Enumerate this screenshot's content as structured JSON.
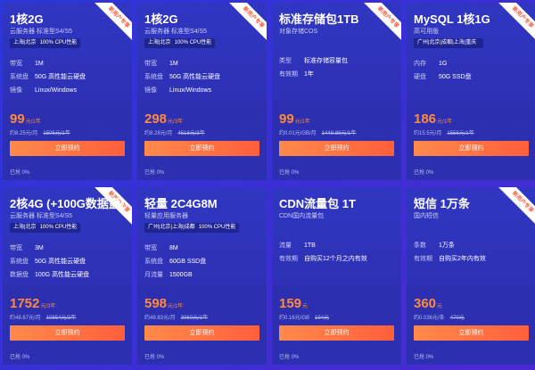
{
  "cards": [
    {
      "badge": "新用户专享",
      "title": "1核2G",
      "subtitle": "云服务器 标准型S4/S5",
      "tag_a": "上海|北京",
      "tag_b": "100% CPU性能",
      "specs": [
        [
          "带宽",
          "1M"
        ],
        [
          "系统盘",
          "50G 高性能云硬盘"
        ],
        [
          "镜像",
          "Linux/Windows"
        ]
      ],
      "price": "99",
      "unit": "元/1年",
      "sub": "约8.25元/月",
      "orig": "1506元/1年",
      "button": "立即预约",
      "sold": "已抢 0%"
    },
    {
      "badge": "新用户专享",
      "title": "1核2G",
      "subtitle": "云服务器 标准型S4/S5",
      "tag_a": "上海|北京",
      "tag_b": "100% CPU性能",
      "specs": [
        [
          "带宽",
          "1M"
        ],
        [
          "系统盘",
          "50G 高性能云硬盘"
        ],
        [
          "镜像",
          "Linux/Windows"
        ]
      ],
      "price": "298",
      "unit": "元/3年",
      "sub": "约8.28元/月",
      "orig": "4518元/3年",
      "button": "立即预约",
      "sold": "已抢 0%"
    },
    {
      "badge": "新用户专享",
      "title": "标准存储包1TB",
      "subtitle": "对象存储COS",
      "tag_a": "",
      "tag_b": "",
      "specs": [
        [
          "类型",
          "标准存储容量包"
        ],
        [
          "有效期",
          "1年"
        ]
      ],
      "price": "99",
      "unit": "元/1年",
      "sub": "约0.01元/GB/月",
      "orig": "1449.88元/1年",
      "button": "立即预约",
      "sold": "已抢 0%"
    },
    {
      "badge": "新用户专享",
      "title": "MySQL 1核1G",
      "subtitle": "高可用版",
      "tag_a": "广州|北京|成都|上海|重庆",
      "tag_b": "",
      "specs": [
        [
          "内存",
          "1G"
        ],
        [
          "硬盘",
          "50G SSD盘"
        ]
      ],
      "price": "186",
      "unit": "元/1年",
      "sub": "约15.5元/月",
      "orig": "1556元/1年",
      "button": "立即预约",
      "sold": "已抢 0%"
    },
    {
      "badge": "新用户专享",
      "title": "2核4G (+100G数据盘)",
      "subtitle": "云服务器 标准型S4/S5",
      "tag_a": "上海|北京",
      "tag_b": "100% CPU性能",
      "specs": [
        [
          "带宽",
          "3M"
        ],
        [
          "系统盘",
          "50G 高性能云硬盘"
        ],
        [
          "数据盘",
          "100G 高性能云硬盘"
        ]
      ],
      "price": "1752",
      "unit": "元/3年",
      "sub": "约48.67元/月",
      "orig": "10854元/3年",
      "button": "立即预约",
      "sold": "已抢 0%"
    },
    {
      "badge": "",
      "title": "轻量 2C4G8M",
      "subtitle": "轻量应用服务器",
      "tag_a": "广州|北京|上海|成都",
      "tag_b": "100% CPU性能",
      "specs": [
        [
          "带宽",
          "8M"
        ],
        [
          "系统盘",
          "60GB SSD盘"
        ],
        [
          "月流量",
          "1500GB"
        ]
      ],
      "price": "598",
      "unit": "元/1年",
      "sub": "约49.83元/月",
      "orig": "3060元/1年",
      "button": "立即预约",
      "sold": "已抢 0%"
    },
    {
      "badge": "",
      "title": "CDN流量包 1T",
      "subtitle": "CDN国内流量包",
      "tag_a": "",
      "tag_b": "",
      "specs": [
        [
          "流量",
          "1TB"
        ],
        [
          "有效期",
          "自购买12个月之内有效"
        ]
      ],
      "price": "159",
      "unit": "元",
      "sub": "约0.16元/GB",
      "orig": "194元",
      "button": "立即预约",
      "sold": "已抢 0%"
    },
    {
      "badge": "新用户专享",
      "title": "短信 1万条",
      "subtitle": "国内短信",
      "tag_a": "",
      "tag_b": "",
      "specs": [
        [
          "条数",
          "1万条"
        ],
        [
          "有效期",
          "自购买2年内有效"
        ]
      ],
      "price": "360",
      "unit": "元",
      "sub": "约0.036元/条",
      "orig": "470元",
      "button": "立即预约",
      "sold": "已抢 0%"
    }
  ]
}
